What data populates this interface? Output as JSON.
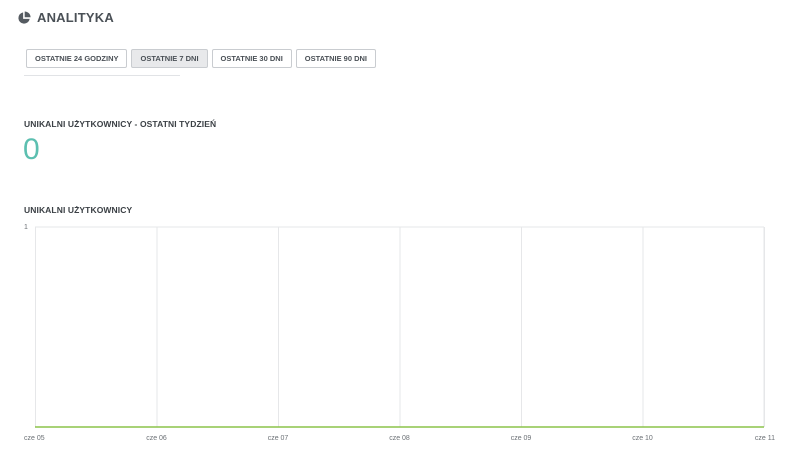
{
  "header": {
    "icon": "pie-chart-icon",
    "title": "ANALITYKA"
  },
  "tabs": [
    {
      "label": "OSTATNIE 24 GODZINY",
      "active": false
    },
    {
      "label": "OSTATNIE 7 DNI",
      "active": true
    },
    {
      "label": "OSTATNIE 30 DNI",
      "active": false
    },
    {
      "label": "OSTATNIE 90 DNI",
      "active": false
    }
  ],
  "weekly": {
    "title": "UNIKALNI UŻYTKOWNICY - OSTATNI TYDZIEŃ",
    "value": "0"
  },
  "chart_section": {
    "title": "UNIKALNI UŻYTKOWNICY"
  },
  "colors": {
    "accent": "#5cbfb0",
    "line": "#8bc34a",
    "grid": "#e6e7e9"
  },
  "chart_data": {
    "type": "line",
    "title": "UNIKALNI UŻYTKOWNICY",
    "x": [
      "cze 05",
      "cze 06",
      "cze 07",
      "cze 08",
      "cze 09",
      "cze 10",
      "cze 11"
    ],
    "series": [
      {
        "values": [
          0,
          0,
          0,
          0,
          0,
          0,
          0
        ]
      }
    ],
    "y_tick_labels": [
      "1"
    ],
    "ylim": [
      0,
      1
    ],
    "grid": true
  }
}
